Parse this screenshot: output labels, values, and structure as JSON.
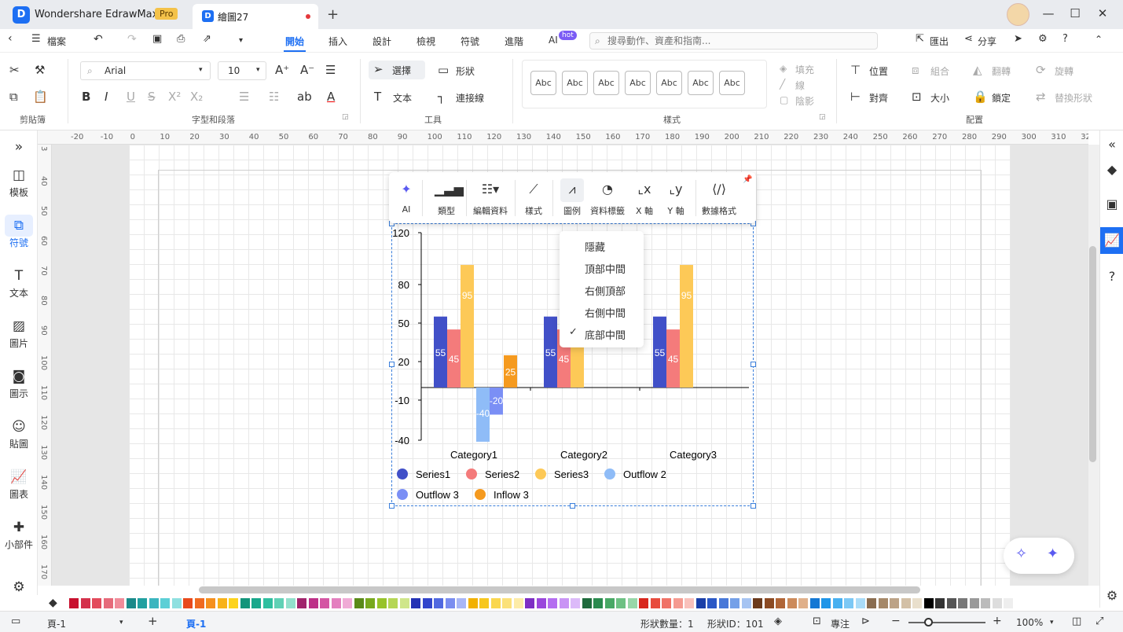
{
  "titlebar": {
    "app_name": "Wondershare EdrawMax",
    "pro_badge": "Pro",
    "document_tab": "繪圖27",
    "new_tab": "+",
    "minimize": "—",
    "maximize": "☐",
    "close": "✕"
  },
  "menubar": {
    "file": "檔案",
    "tabs": [
      "開始",
      "插入",
      "設計",
      "檢視",
      "符號",
      "進階",
      "AI"
    ],
    "active_tab": "開始",
    "ai_badge": "hot",
    "search_placeholder": "搜尋動作、資產和指南...",
    "export": "匯出",
    "share": "分享"
  },
  "ribbon": {
    "groups": {
      "clipboard": "剪貼簿",
      "font_paragraph": "字型和段落",
      "tools": "工具",
      "styles": "樣式",
      "arrange": "配置"
    },
    "font_name": "Arial",
    "font_size": "10",
    "select": "選擇",
    "shape": "形狀",
    "text": "文本",
    "connector": "連接線",
    "style_sample": "Abc",
    "fill": "填充",
    "line": "線",
    "shadow": "陰影",
    "position": "位置",
    "group": "組合",
    "flip": "翻轉",
    "rotate": "旋轉",
    "align": "對齊",
    "size": "大小",
    "lock": "鎖定",
    "replace_shape": "替換形狀"
  },
  "leftpanel": {
    "items": [
      "模板",
      "符號",
      "文本",
      "圖片",
      "圖示",
      "貼圖",
      "圖表",
      "小部件"
    ],
    "active": "符號"
  },
  "ruler": {
    "h_labels": [
      "-20",
      "-10",
      "0",
      "10",
      "20",
      "30",
      "40",
      "50",
      "60",
      "70",
      "80",
      "90",
      "100",
      "110",
      "120",
      "130",
      "140",
      "150",
      "160",
      "170",
      "180",
      "190",
      "200",
      "210",
      "220",
      "230",
      "240",
      "250",
      "260",
      "270",
      "280",
      "290",
      "300",
      "310",
      "32"
    ],
    "v_labels": [
      "3",
      "40",
      "50",
      "60",
      "70",
      "80",
      "90",
      "100",
      "110",
      "120",
      "130",
      "140",
      "150",
      "160",
      "170"
    ]
  },
  "chart_toolbar": {
    "items": [
      "AI",
      "類型",
      "編輯資料",
      "樣式",
      "圖例",
      "資料標籤",
      "X 軸",
      "Y 軸",
      "數據格式"
    ],
    "active": "圖例"
  },
  "legend_menu": {
    "items": [
      "隱藏",
      "頂部中間",
      "右側頂部",
      "右側中間",
      "底部中間"
    ],
    "selected": "底部中間"
  },
  "chart_data": {
    "type": "bar",
    "categories": [
      "Category1",
      "Category2",
      "Category3"
    ],
    "y_ticks": [
      "120",
      "80",
      "50",
      "20",
      "-10",
      "-40"
    ],
    "series": [
      {
        "name": "Series1",
        "color": "#4150c8",
        "values": [
          55,
          55,
          55
        ]
      },
      {
        "name": "Series2",
        "color": "#f47b7b",
        "values": [
          45,
          45,
          45
        ]
      },
      {
        "name": "Series3",
        "color": "#fdc957",
        "values": [
          95,
          95,
          95
        ]
      },
      {
        "name": "Outflow 2",
        "color": "#8fbcf7",
        "values": [
          -40,
          null,
          null
        ]
      },
      {
        "name": "Outflow 3",
        "color": "#7b8ff5",
        "values": [
          -20,
          null,
          null
        ]
      },
      {
        "name": "Inflow 3",
        "color": "#f59a1f",
        "values": [
          25,
          null,
          null
        ]
      }
    ],
    "legend": "bottom-center",
    "grid": false
  },
  "statusbar": {
    "page_selector": "頁-1",
    "add_page": "+",
    "active_page": "頁-1",
    "shape_count": "形狀數量：1",
    "shape_id": "形狀ID：101",
    "focus": "專注",
    "zoom": "100%"
  },
  "palette_colors": [
    "#c8102e",
    "#d4314b",
    "#e34b5c",
    "#e66a7a",
    "#f08c9a",
    "#1a8a8a",
    "#21a0a0",
    "#3bb5bf",
    "#5ccfd6",
    "#8fe0e0",
    "#e84a1c",
    "#f06a20",
    "#f5901e",
    "#f8b21a",
    "#fdd31c",
    "#12957a",
    "#18a78b",
    "#2fbf9f",
    "#5fd1b5",
    "#92e0cc",
    "#a0246c",
    "#bd2f87",
    "#d455a3",
    "#e47fbf",
    "#f0aad6",
    "#5a8a18",
    "#78a91e",
    "#97c32a",
    "#b5d655",
    "#cfe68a",
    "#2432b5",
    "#3245cc",
    "#5068e0",
    "#7a8df0",
    "#a8b6f6",
    "#f2b100",
    "#f7c71e",
    "#fad74f",
    "#fbe17a",
    "#fdeca8",
    "#7d2ec4",
    "#9a46dc",
    "#b46df0",
    "#c994f5",
    "#dcbaf9",
    "#1f6b3c",
    "#2a8a4e",
    "#48a865",
    "#6dc183",
    "#98d6a8",
    "#d8261c",
    "#e84c3d",
    "#f07266",
    "#f59a90",
    "#f9c1bb",
    "#1a3fa8",
    "#2a58c6",
    "#4878d8",
    "#74a0e8",
    "#a6c4f2",
    "#6b3a1c",
    "#8c4a22",
    "#b06536",
    "#cc8a5a",
    "#e0b08a",
    "#1478d4",
    "#1e95e8",
    "#48b0f0",
    "#7cc8f5",
    "#aadcf8",
    "#8a6d50",
    "#a58868",
    "#bca286",
    "#d3c0a6",
    "#e9dfcc",
    "#000000",
    "#333333",
    "#555555",
    "#777777",
    "#999999",
    "#bbbbbb",
    "#dddddd",
    "#eeeeee"
  ]
}
